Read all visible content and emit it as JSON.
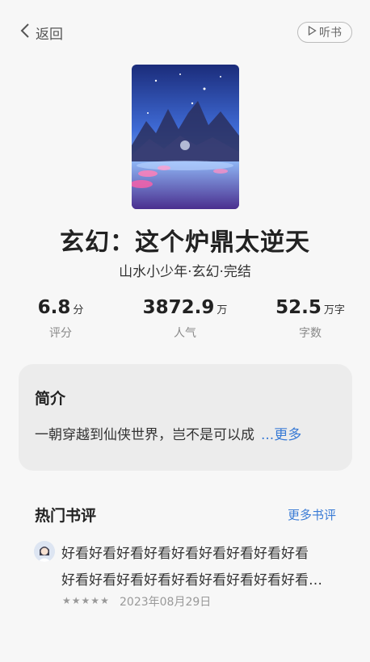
{
  "topbar": {
    "back_label": "返回",
    "listen_label": "听书"
  },
  "book": {
    "title": "玄幻：这个炉鼎太逆天",
    "meta": "山水小少年·玄幻·完结"
  },
  "stats": [
    {
      "value": "6.8",
      "unit": "分",
      "label": "评分"
    },
    {
      "value": "3872.9",
      "unit": "万",
      "label": "人气"
    },
    {
      "value": "52.5",
      "unit": "万字",
      "label": "字数"
    }
  ],
  "intro": {
    "heading": "简介",
    "text": "一朝穿越到仙侠世界，岂不是可以成",
    "more": "...更多"
  },
  "reviews_section": {
    "heading": "热门书评",
    "more": "更多书评",
    "items": [
      {
        "line1": "好看好看好看好看好看好看好看好看好看",
        "line2": "好看好看好看好看好看好看好看好看好看…",
        "rating": 5,
        "date": "2023年08月29日"
      }
    ]
  },
  "colors": {
    "accent": "#3a7bd5",
    "background": "#f7f7f7",
    "card": "#ececec"
  }
}
